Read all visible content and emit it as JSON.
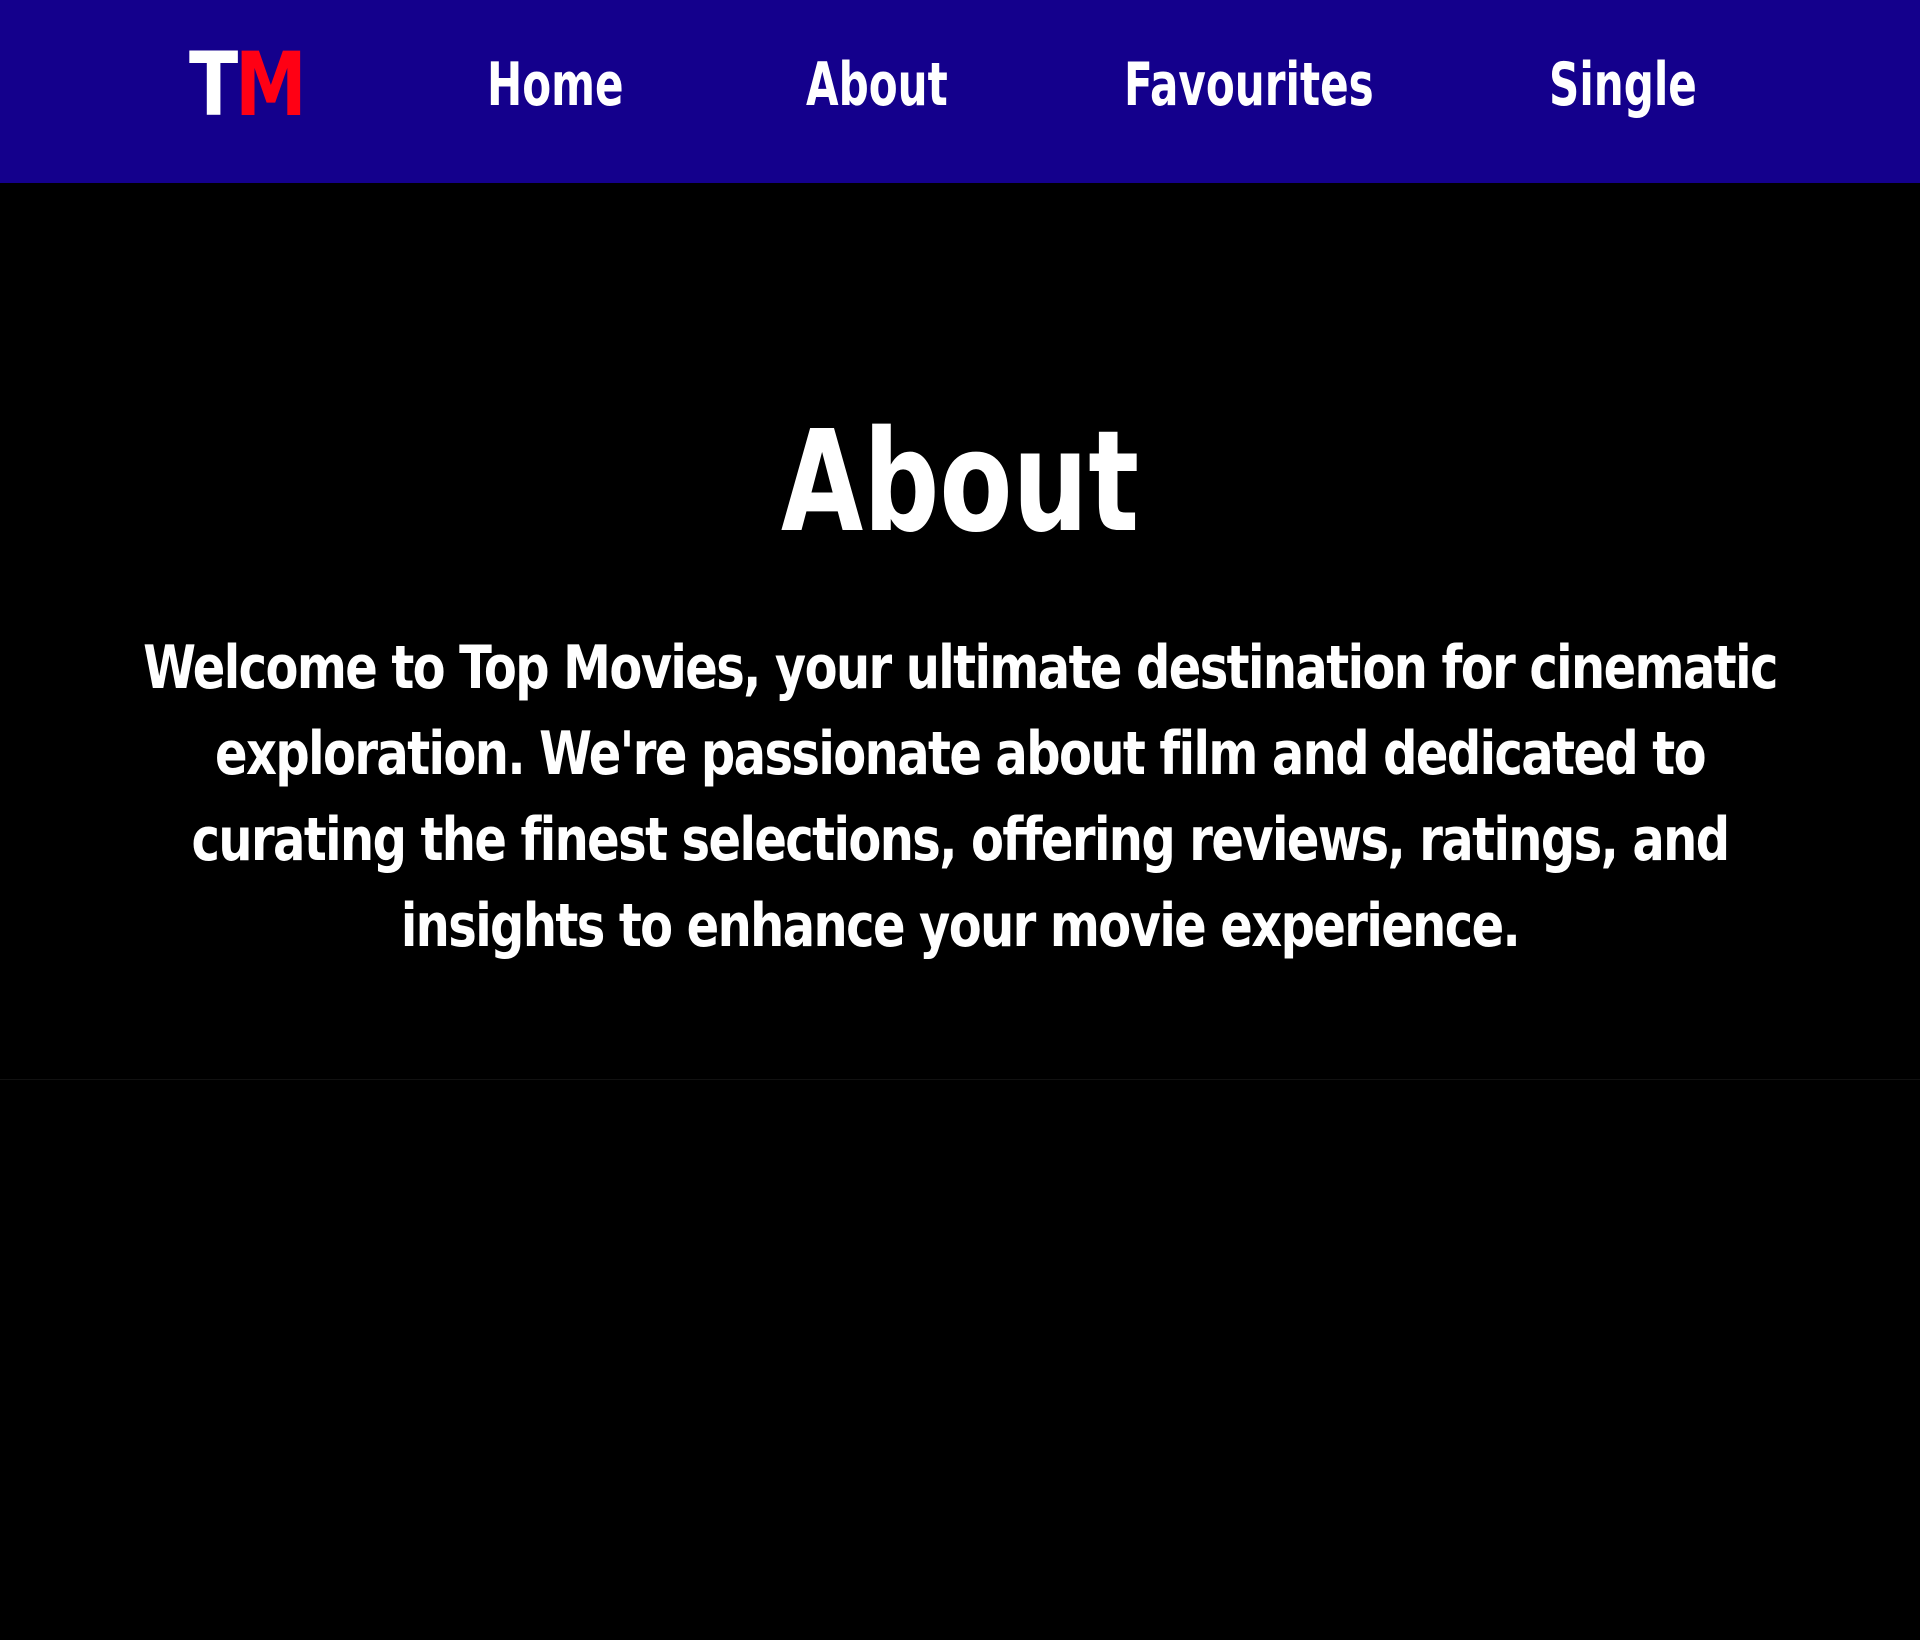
{
  "header": {
    "logo": {
      "first_letter": "T",
      "second_letter": "M",
      "first_color": "#ffffff",
      "second_color": "#ff0014"
    },
    "nav": [
      {
        "label": "Home"
      },
      {
        "label": "About"
      },
      {
        "label": "Favourites"
      },
      {
        "label": "Single"
      }
    ],
    "background_color": "#14008c"
  },
  "about": {
    "title": "About",
    "body": "Welcome to Top Movies, your ultimate destination for cinematic exploration. We're passionate about film and dedicated to curating the finest selections, offering reviews, ratings, and insights to enhance your movie experience."
  }
}
